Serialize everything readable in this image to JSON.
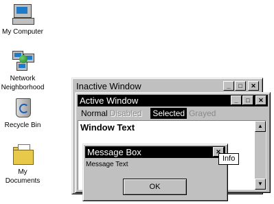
{
  "desktop": {
    "icons": [
      {
        "label": "My Computer",
        "icon": "computer-icon"
      },
      {
        "label": "Network\nNeighborhood",
        "icon": "network-icon"
      },
      {
        "label": "Recycle Bin",
        "icon": "recycle-bin-icon"
      },
      {
        "label": "My\nDocuments",
        "icon": "documents-icon"
      }
    ]
  },
  "inactive_window": {
    "title": "Inactive Window",
    "buttons": {
      "minimize": "_",
      "maximize": "□",
      "close": "✕"
    }
  },
  "active_window": {
    "title": "Active Window",
    "buttons": {
      "minimize": "_",
      "maximize": "□",
      "close": "✕"
    },
    "menu": {
      "normal": "Normal",
      "disabled": "Disabled",
      "selected": "Selected",
      "grayed": "Grayed"
    },
    "window_text": "Window Text",
    "scroll": {
      "up": "▲",
      "down": "▼"
    }
  },
  "message_box": {
    "title": "Message Box",
    "close": "✕",
    "text": "Message Text",
    "ok_label": "OK"
  },
  "tooltip": {
    "text": "Info"
  },
  "colors": {
    "desktop": "#ffffff",
    "face": "#c0c0c0",
    "active_title": "#000000",
    "inactive_title": "#c0c0c0"
  }
}
